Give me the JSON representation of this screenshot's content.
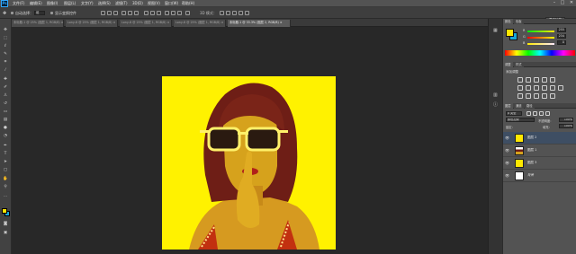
{
  "app": {
    "logo": "Ps"
  },
  "menu": [
    "文件(F)",
    "编辑(E)",
    "图像(I)",
    "图层(L)",
    "文字(Y)",
    "选择(S)",
    "滤镜(T)",
    "3D(D)",
    "视图(V)",
    "窗口(W)",
    "帮助(H)"
  ],
  "window_controls": {
    "minimize": "–",
    "maximize": "□",
    "close": "✕"
  },
  "options_bar": {
    "auto_select_label": "自动选择：",
    "auto_select_value": "组",
    "transform_controls_label": "显示变换控件",
    "workspace": "基本功能"
  },
  "tabs": [
    {
      "label": "未标题-1 @ 25% (图层 1, RGB/8) ×",
      "active": false
    },
    {
      "label": "Lony-8 @ 25% (图层 1, RGB/8) ×",
      "active": false
    },
    {
      "label": "Lony-8 @ 25% (图层 1, RGB/8) ×",
      "active": false
    },
    {
      "label": "Lony-8 @ 25% (图层 1, RGB/8) ×",
      "active": false
    },
    {
      "label": "未标题-1 @ 33.3% (图层 2, RGB/8) ×",
      "active": true
    }
  ],
  "color_panel": {
    "tabs": [
      "颜色",
      "色板"
    ],
    "r_label": "R",
    "r_value": "255",
    "g_label": "G",
    "g_value": "234",
    "b_label": "B",
    "b_value": "0"
  },
  "adjustments_panel": {
    "tabs": [
      "调整",
      "样式"
    ],
    "add_label": "添加调整"
  },
  "layers_panel": {
    "tabs": [
      "图层",
      "通道",
      "路径"
    ],
    "blend_mode": "颜色加深",
    "opacity_label": "不透明度：",
    "opacity_value": "100%",
    "lock_label": "锁定：",
    "fill_label": "填充：",
    "fill_value": "100%",
    "layers": [
      {
        "name": "图层 2",
        "thumb": "#ffe800",
        "active": true
      },
      {
        "name": "图层 1",
        "thumb": "photo",
        "active": false
      },
      {
        "name": "图层 3",
        "thumb": "#ffe800",
        "active": false
      },
      {
        "name": "背景",
        "thumb": "#ffffff",
        "active": false
      }
    ]
  },
  "colors": {
    "foreground": "#ffe600",
    "background": "#18a6d8",
    "canvas_fill": "#fff200",
    "ui_dark": "#282828",
    "ui_panel": "#535353"
  },
  "icons": [
    "photoshop-logo-icon",
    "move-tool-icon",
    "marquee-tool-icon",
    "lasso-tool-icon",
    "quick-selection-icon",
    "crop-tool-icon",
    "eyedropper-icon",
    "healing-brush-icon",
    "brush-tool-icon",
    "clone-stamp-icon",
    "history-brush-icon",
    "eraser-icon",
    "gradient-icon",
    "blur-icon",
    "dodge-icon",
    "pen-icon",
    "type-icon",
    "path-selection-icon",
    "shape-icon",
    "hand-icon",
    "zoom-icon",
    "eye-icon"
  ]
}
